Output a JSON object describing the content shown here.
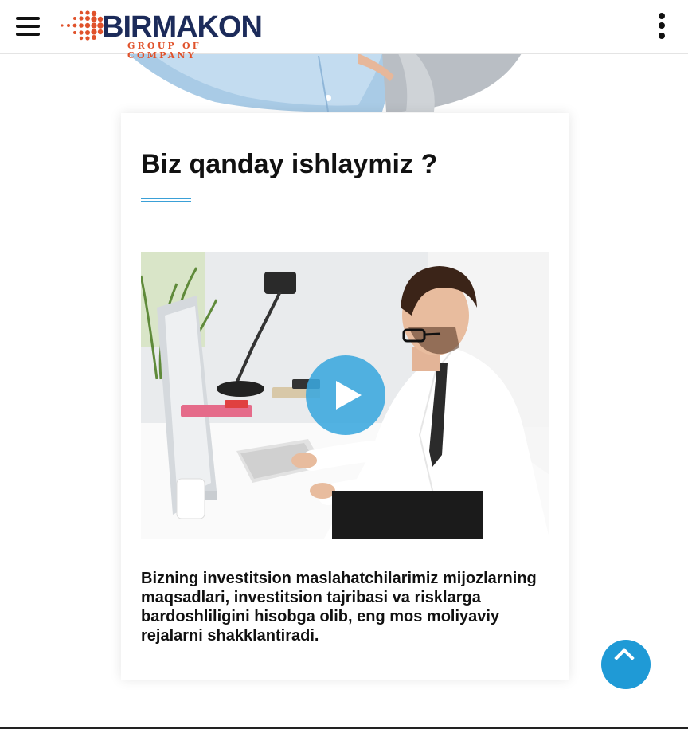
{
  "header": {
    "logo_main": "BIRMAKON",
    "logo_sub": "GROUP OF COMPANY",
    "menu_icon": "hamburger-menu-icon",
    "more_icon": "vertical-dots-icon"
  },
  "section": {
    "title": "Biz qanday ishlaymiz ?",
    "description": "Bizning investitsion maslahatchilarimiz mijozlarning maqsadlari, investitsion tajribasi va risklarga bardoshliligini hisobga olib, eng mos moliyaviy rejalarni shakklantiradi."
  },
  "video": {
    "play_icon": "play-icon"
  },
  "scroll_top": {
    "icon": "chevron-up-icon"
  },
  "colors": {
    "brand_navy": "#1c2b5a",
    "brand_orange": "#e0522b",
    "accent_blue": "#1f9ad6"
  }
}
